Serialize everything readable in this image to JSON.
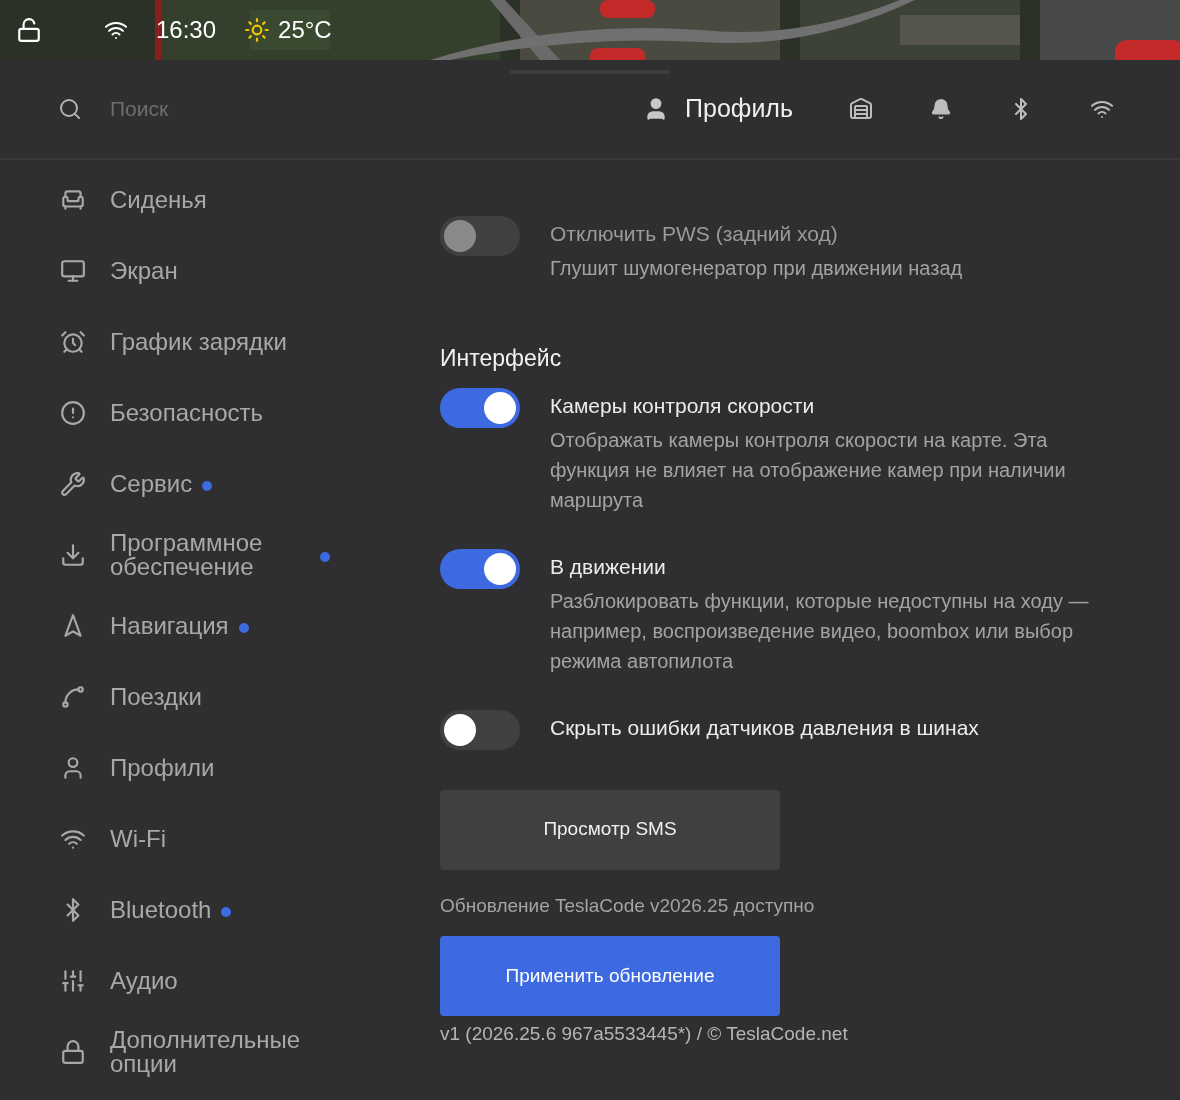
{
  "status_bar": {
    "locked": false,
    "time": "16:30",
    "temperature": "25°C"
  },
  "header": {
    "search": {
      "placeholder": "Поиск"
    },
    "profile": "Профиль"
  },
  "sidebar": {
    "items": [
      {
        "label": "Сиденья",
        "badge": false
      },
      {
        "label": "Экран",
        "badge": false
      },
      {
        "label": "График зарядки",
        "badge": false
      },
      {
        "label": "Безопасность",
        "badge": false
      },
      {
        "label": "Сервис",
        "badge": true
      },
      {
        "label": "Программное обеспечение",
        "badge": true
      },
      {
        "label": "Навигация",
        "badge": true
      },
      {
        "label": "Поездки",
        "badge": false
      },
      {
        "label": "Профили",
        "badge": false
      },
      {
        "label": "Wi-Fi",
        "badge": false
      },
      {
        "label": "Bluetooth",
        "badge": true
      },
      {
        "label": "Аудио",
        "badge": false
      },
      {
        "label": "Дополнительные опции",
        "badge": false
      }
    ]
  },
  "settings": {
    "top": [
      {
        "title": "Отключить PWS (задний ход)",
        "description": "Глушит шумогенератор при движении назад",
        "on": false,
        "disabled": true
      }
    ],
    "section_title": "Интерфейс",
    "items": [
      {
        "title": "Камеры контроля скорости",
        "description": "Отображать камеры контроля скорости на карте. Эта функция не влияет на отображение камер при наличии маршрута",
        "on": true,
        "disabled": false
      },
      {
        "title": "В движении",
        "description": "Разблокировать функции, которые недоступны на ходу — например, воспроизведение видео, boombox или выбор режима автопилота",
        "on": true,
        "disabled": false
      },
      {
        "title": "Скрыть ошибки датчиков давления в шинах",
        "on": false,
        "disabled": false
      }
    ],
    "sms_button": "Просмотр SMS",
    "update_notice": "Обновление TeslaCode v2026.25 доступно",
    "update_button": "Применить обновление",
    "version": "v1 (2026.25.6 967a5533445*) / © TeslaCode.net"
  }
}
